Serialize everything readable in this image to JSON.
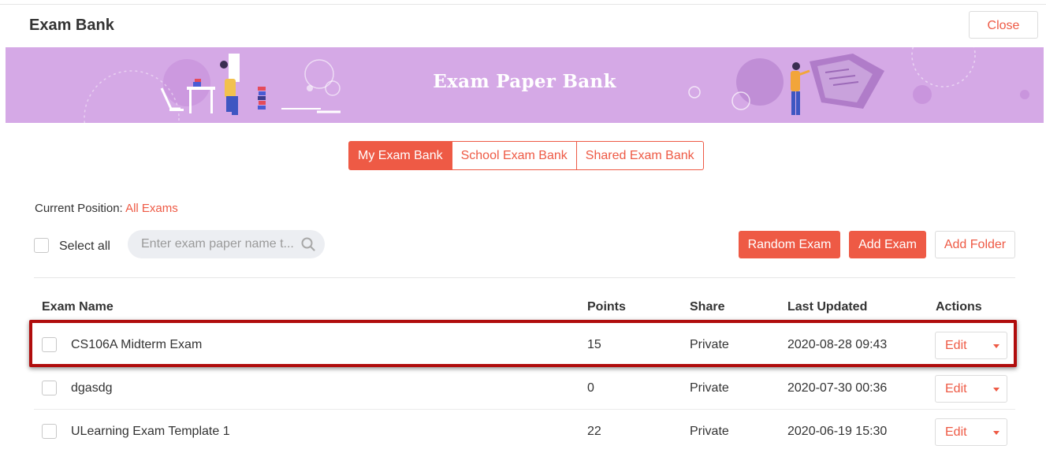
{
  "header": {
    "title": "Exam Bank",
    "close_label": "Close"
  },
  "banner": {
    "title": "Exam Paper Bank"
  },
  "tabs": [
    {
      "label": "My Exam Bank",
      "active": true
    },
    {
      "label": "School Exam Bank",
      "active": false
    },
    {
      "label": "Shared Exam Bank",
      "active": false
    }
  ],
  "breadcrumb": {
    "prefix": "Current Position:",
    "current": "All Exams"
  },
  "toolbar": {
    "select_all_label": "Select all",
    "search_placeholder": "Enter exam paper name t...",
    "random_exam_label": "Random Exam",
    "add_exam_label": "Add Exam",
    "add_folder_label": "Add Folder"
  },
  "table": {
    "columns": [
      "Exam Name",
      "Points",
      "Share",
      "Last Updated",
      "Actions"
    ],
    "rows": [
      {
        "name": "CS106A Midterm Exam",
        "points": "15",
        "share": "Private",
        "updated": "2020-08-28 09:43",
        "action": "Edit"
      },
      {
        "name": "dgasdg",
        "points": "0",
        "share": "Private",
        "updated": "2020-07-30 00:36",
        "action": "Edit"
      },
      {
        "name": "ULearning Exam Template 1",
        "points": "22",
        "share": "Private",
        "updated": "2020-06-19 15:30",
        "action": "Edit"
      }
    ]
  },
  "colors": {
    "accent": "#ee5a45",
    "banner": "#d5a9e6",
    "highlight": "#b00d0d"
  }
}
